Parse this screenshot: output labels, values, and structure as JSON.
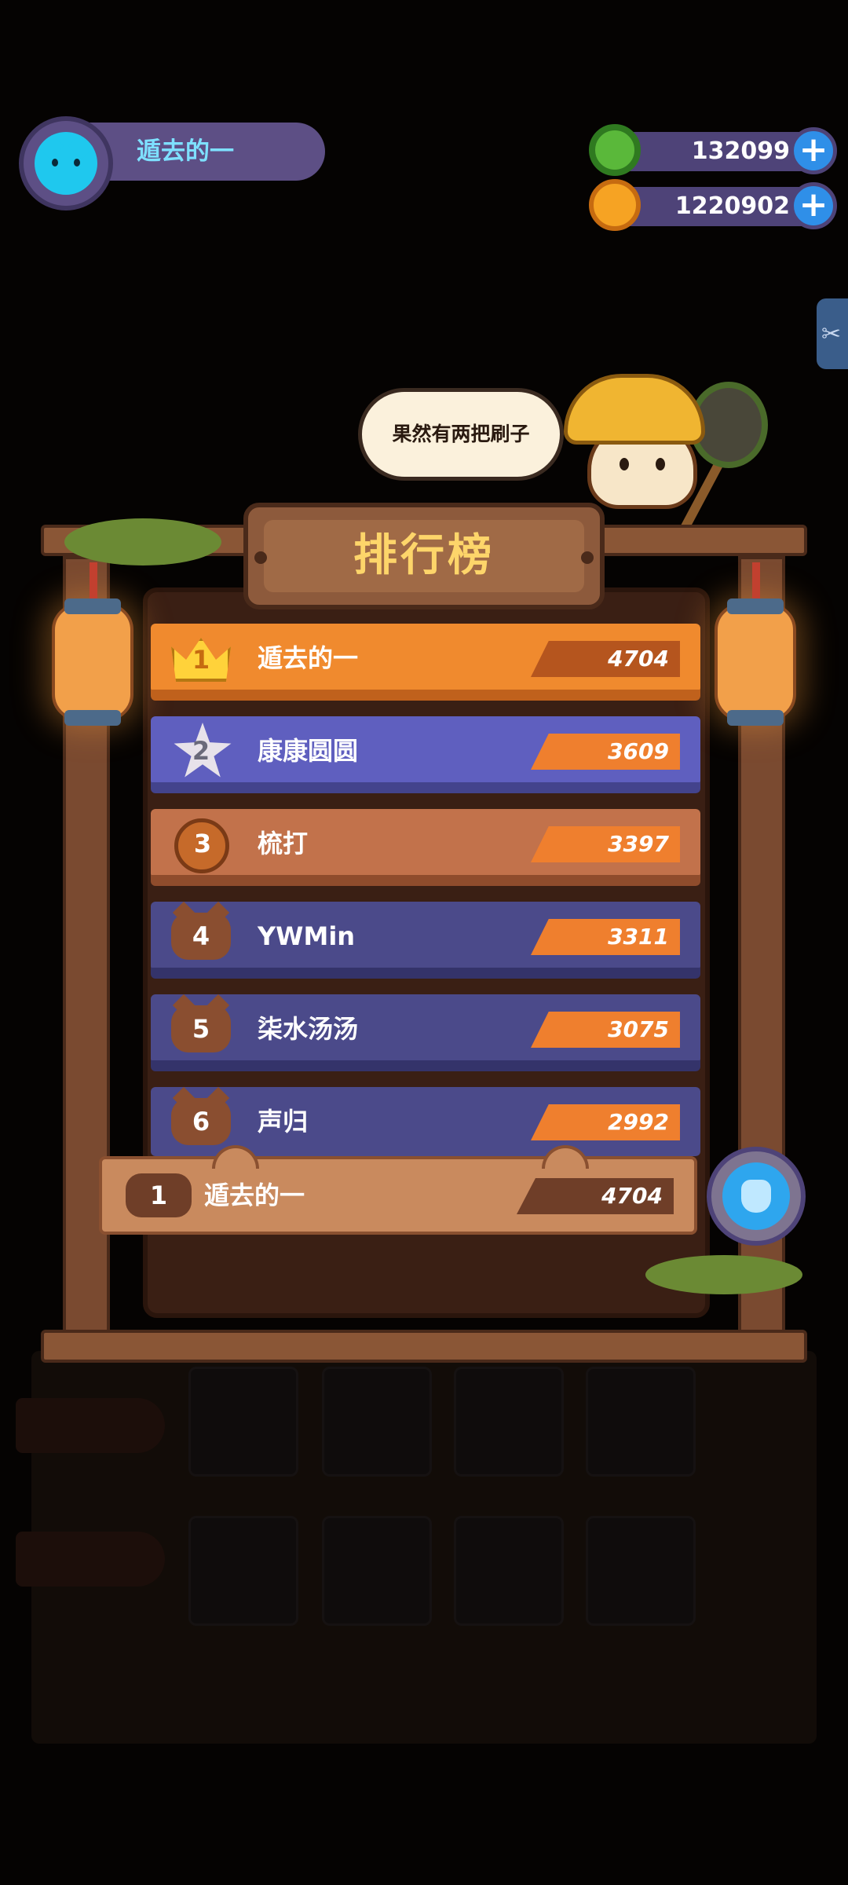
{
  "player": {
    "name": "遁去的一",
    "avatar_icon": "cat-avatar-icon"
  },
  "currencies": [
    {
      "name": "donut",
      "icon": "donut-icon",
      "value": "132099",
      "add_icon": "plus-icon"
    },
    {
      "name": "planet-coin",
      "icon": "planet-coin-icon",
      "value": "1220902",
      "add_icon": "plus-icon"
    }
  ],
  "speech_bubble": "果然有两把刷子",
  "leaderboard": {
    "title": "排行榜",
    "rows": [
      {
        "rank": "1",
        "name": "遁去的一",
        "score": "4704",
        "badge": "crown-icon",
        "color": "#f08a2e",
        "score_color": "#b5551e"
      },
      {
        "rank": "2",
        "name": "康康圆圆",
        "score": "3609",
        "badge": "silver-star-icon",
        "color": "#5f5fbf",
        "score_color": "#ef7f2e"
      },
      {
        "rank": "3",
        "name": "梳打",
        "score": "3397",
        "badge": "bronze-medal-icon",
        "color": "#c2724b",
        "score_color": "#ef7f2e"
      },
      {
        "rank": "4",
        "name": "YWMin",
        "score": "3311",
        "badge": "cat-head-icon",
        "color": "#4b4a8a",
        "score_color": "#ef7f2e"
      },
      {
        "rank": "5",
        "name": "柒水汤汤",
        "score": "3075",
        "badge": "cat-head-icon",
        "color": "#4b4a8a",
        "score_color": "#ef7f2e"
      },
      {
        "rank": "6",
        "name": "声归",
        "score": "2992",
        "badge": "cat-head-icon",
        "color": "#4b4a8a",
        "score_color": "#ef7f2e"
      }
    ],
    "my_rank": {
      "rank": "1",
      "name": "遁去的一",
      "score": "4704",
      "badge": "cat-head-icon"
    }
  },
  "bag_button_icon": "gift-bag-icon",
  "side_tab_icon": "scissors-icon"
}
